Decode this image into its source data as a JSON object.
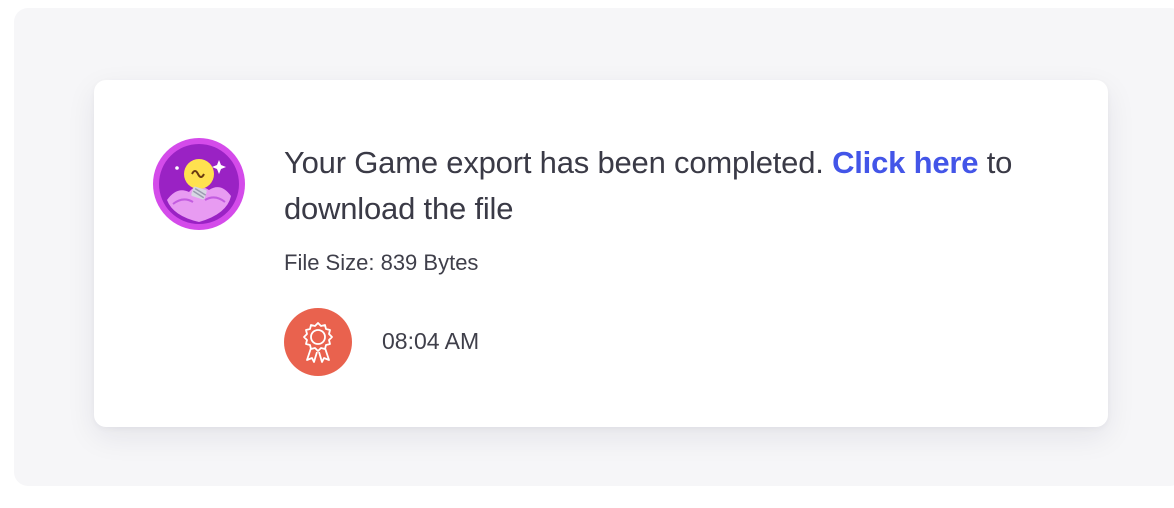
{
  "notification": {
    "message_prefix": "Your Game export has been completed. ",
    "link_label": "Click here",
    "message_suffix": " to download the file",
    "file_size": "File Size: 839 Bytes",
    "time": "08:04 AM",
    "avatar_icon": "lightbulb-idea-badge-icon",
    "badge_icon": "award-ribbon-icon"
  },
  "colors": {
    "link": "#4355e8",
    "badge_bg": "#e9624e",
    "avatar_bg": "#b02fd6"
  }
}
